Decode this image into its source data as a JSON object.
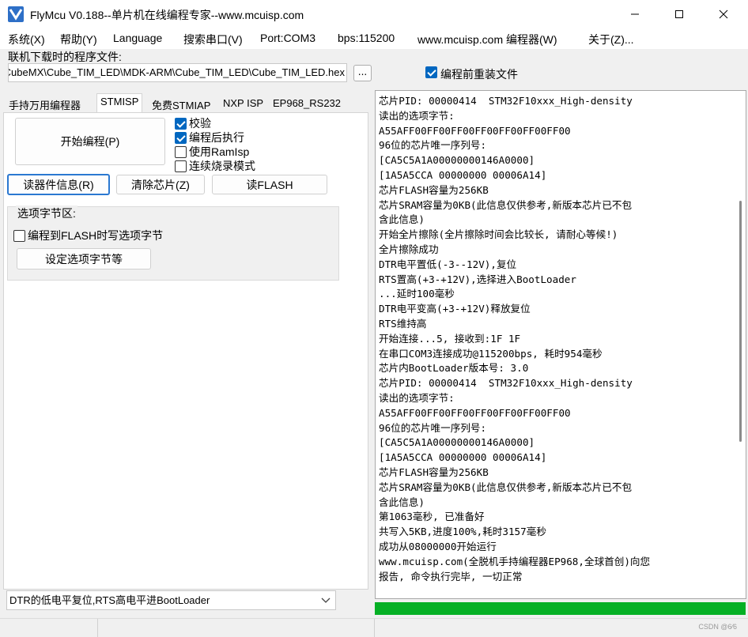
{
  "window": {
    "title": "FlyMcu V0.188--单片机在线编程专家--www.mcuisp.com"
  },
  "menu": [
    {
      "label": "系统(X)"
    },
    {
      "label": "帮助(Y)"
    },
    {
      "label": "Language"
    },
    {
      "label": "搜索串口(V)"
    },
    {
      "label": "Port:COM3"
    },
    {
      "label": "bps:115200"
    },
    {
      "label": "www.mcuisp.com 编程器(W)"
    },
    {
      "label": "关于(Z)..."
    }
  ],
  "file": {
    "label": "联机下载时的程序文件:",
    "path": "CubeMX\\Cube_TIM_LED\\MDK-ARM\\Cube_TIM_LED\\Cube_TIM_LED.hex",
    "browse_label": "...",
    "reload_label": "编程前重装文件",
    "reload_checked": true
  },
  "tabs": [
    {
      "label": "手持万用编程器",
      "active": false
    },
    {
      "label": "STMISP",
      "active": true
    },
    {
      "label": "免费STMIAP",
      "active": false
    },
    {
      "label": "NXP ISP",
      "active": false
    },
    {
      "label": "EP968_RS232",
      "active": false
    }
  ],
  "stmisp": {
    "start_label": "开始编程(P)",
    "options": [
      {
        "label": "校验",
        "checked": true
      },
      {
        "label": "编程后执行",
        "checked": true
      },
      {
        "label": "使用RamIsp",
        "checked": false
      },
      {
        "label": "连续烧录模式",
        "checked": false
      }
    ],
    "read_info_label": "读器件信息(R)",
    "erase_label": "清除芯片(Z)",
    "read_flash_label": "读FLASH",
    "option_group": {
      "title": "选项字节区:",
      "write_option_label": "编程到FLASH时写选项字节",
      "write_option_checked": false,
      "set_option_label": "设定选项字节等"
    }
  },
  "reset_mode": "DTR的低电平复位,RTS高电平进BootLoader",
  "log": [
    "芯片PID: 00000414  STM32F10xxx_High-density",
    "读出的选项字节:",
    "A55AFF00FF00FF00FF00FF00FF00FF00",
    "96位的芯片唯一序列号:",
    "[CA5C5A1A00000000146A0000]",
    "[1A5A5CCA 00000000 00006A14]",
    "芯片FLASH容量为256KB",
    "芯片SRAM容量为0KB(此信息仅供参考,新版本芯片已不包",
    "含此信息)",
    "开始全片擦除(全片擦除时间会比较长, 请耐心等候!)",
    "全片擦除成功",
    "DTR电平置低(-3--12V),复位",
    "RTS置高(+3-+12V),选择进入BootLoader",
    "...延时100毫秒",
    "DTR电平变高(+3-+12V)释放复位",
    "RTS维持高",
    "开始连接...5, 接收到:1F 1F",
    "在串口COM3连接成功@115200bps, 耗时954毫秒",
    "芯片内BootLoader版本号: 3.0",
    "芯片PID: 00000414  STM32F10xxx_High-density",
    "读出的选项字节:",
    "A55AFF00FF00FF00FF00FF00FF00FF00",
    "96位的芯片唯一序列号:",
    "[CA5C5A1A00000000146A0000]",
    "[1A5A5CCA 00000000 00006A14]",
    "芯片FLASH容量为256KB",
    "芯片SRAM容量为0KB(此信息仅供参考,新版本芯片已不包",
    "含此信息)",
    "第1063毫秒, 已准备好",
    "共写入5KB,进度100%,耗时3157毫秒",
    "成功从08000000开始运行",
    "www.mcuisp.com(全脱机手持编程器EP968,全球首创)向您",
    "报告, 命令执行完毕, 一切正常"
  ],
  "progress": {
    "percent": 100,
    "color": "#06b025"
  },
  "watermark": "CSDN @6⁄6"
}
